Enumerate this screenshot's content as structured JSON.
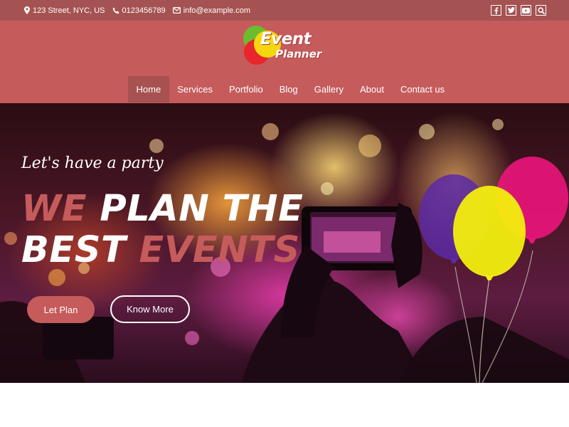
{
  "topbar": {
    "address": "123 Street, NYC, US",
    "phone": "0123456789",
    "email": "info@example.com",
    "socials": [
      "facebook-icon",
      "twitter-icon",
      "youtube-icon",
      "search-icon"
    ]
  },
  "logo": {
    "word1": "Event",
    "word2": "Planner"
  },
  "nav": {
    "items": [
      {
        "label": "Home",
        "active": true
      },
      {
        "label": "Services"
      },
      {
        "label": "Portfolio"
      },
      {
        "label": "Blog"
      },
      {
        "label": "Gallery"
      },
      {
        "label": "About"
      },
      {
        "label": "Contact us"
      }
    ]
  },
  "hero": {
    "tagline": "Let's have a party",
    "headline": {
      "line1_accent": "WE",
      "line1_rest": "PLAN THE",
      "line2_start": "BEST",
      "line2_accent": "EVENTS"
    },
    "primary_button": "Let Plan",
    "secondary_button": "Know More"
  },
  "colors": {
    "topbar": "#a55352",
    "header": "#c65b5c",
    "accent": "#c65b5c",
    "nav_active": "#a75151"
  }
}
